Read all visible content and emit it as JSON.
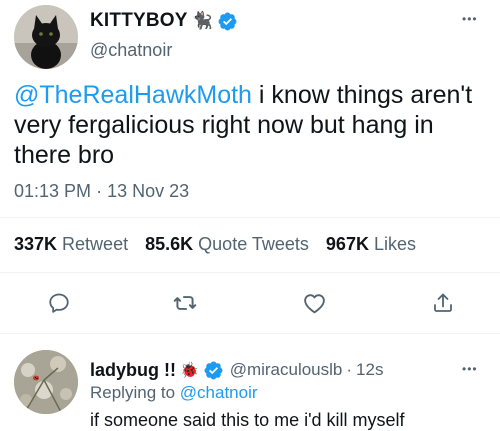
{
  "tweet": {
    "display_name": "KITTYBOY",
    "name_emoji": "🐈‍⬛",
    "handle": "@chatnoir",
    "mention": "@TheRealHawkMoth",
    "text": " i know things aren't very fergalicious right now but hang in there bro",
    "timestamp": "01:13 PM",
    "separator": "·",
    "date": "13 Nov 23",
    "stats": {
      "retweets_count": "337K",
      "retweets_label": "Retweet",
      "quotes_count": "85.6K",
      "quotes_label": "Quote Tweets",
      "likes_count": "967K",
      "likes_label": "Likes"
    },
    "actions": [
      "reply-icon",
      "retweet-icon",
      "like-icon",
      "share-icon"
    ],
    "more_label": "•••"
  },
  "reply": {
    "display_name": "ladybug !!",
    "name_emoji": "🐞",
    "handle": "@miraculouslb",
    "time": "12s",
    "separator": "·",
    "replying_prefix": "Replying to",
    "replying_to": "@chatnoir",
    "text": "if someone said this to me i'd kill myself",
    "more_label": "•••"
  },
  "colors": {
    "accent": "#1d9bf0",
    "muted": "#536471",
    "text": "#0f1419",
    "divider": "#eff3f4"
  }
}
